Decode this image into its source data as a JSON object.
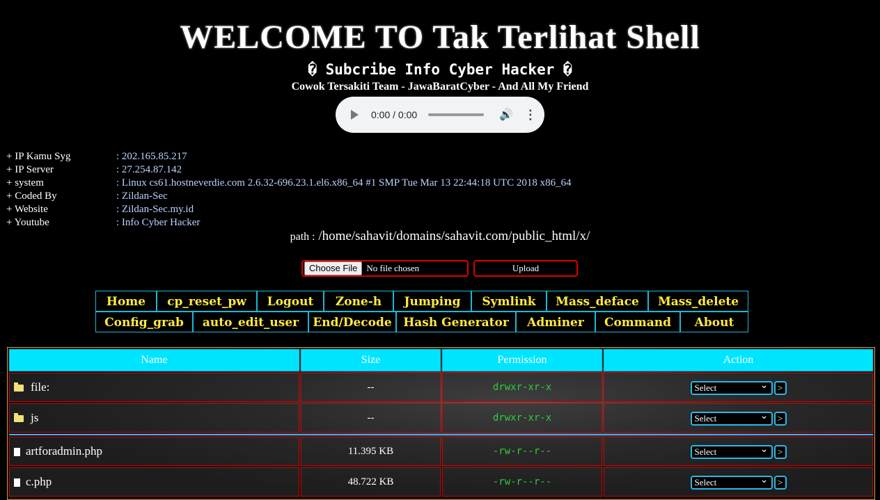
{
  "header": {
    "title": "WELCOME TO Tak Terlihat Shell",
    "subtitle": "� Subcribe Info Cyber Hacker �",
    "credits": "Cowok Tersakiti Team - JawaBaratCyber - And All My Friend"
  },
  "audio": {
    "time": "0:00 / 0:00"
  },
  "info": [
    {
      "key": "+ IP Kamu Syg",
      "value": ": 202.165.85.217"
    },
    {
      "key": "+ IP Server",
      "value": ": 27.254.87.142"
    },
    {
      "key": "+ system",
      "value": ": Linux cs61.hostneverdie.com 2.6.32-696.23.1.el6.x86_64 #1 SMP Tue Mar 13 22:44:18 UTC 2018 x86_64"
    },
    {
      "key": "+ Coded By",
      "value": ": Zildan-Sec"
    },
    {
      "key": "+ Website",
      "value": ": Zildan-Sec.my.id"
    },
    {
      "key": "+ Youtube",
      "value": ": Info Cyber Hacker"
    }
  ],
  "path": {
    "label": "path :",
    "value": "/home/sahavit/domains/sahavit.com/public_html/x/"
  },
  "upload": {
    "choose_label": "Choose File",
    "file_status": "No file chosen",
    "button_label": "Upload"
  },
  "menu": {
    "row1": [
      "Home",
      "cp_reset_pw",
      "Logout",
      "Zone-h",
      "Jumping",
      "Symlink",
      "Mass_deface",
      "Mass_delete"
    ],
    "row2": [
      "Config_grab",
      "auto_edit_user",
      "End/Decode",
      "Hash Generator",
      "Adminer",
      "Command",
      "About"
    ]
  },
  "table": {
    "headers": [
      "Name",
      "Size",
      "Permission",
      "Action"
    ],
    "rows": [
      {
        "type": "folder",
        "name": "file:",
        "size": "--",
        "perm": "drwxr-xr-x",
        "select": "Select",
        "go": ">"
      },
      {
        "type": "folder",
        "name": "js",
        "size": "--",
        "perm": "drwxr-xr-x",
        "select": "Select",
        "go": ">"
      },
      {
        "type": "file",
        "name": "artforadmin.php",
        "size": "11.395 KB",
        "perm": "-rw-r--r--",
        "select": "Select",
        "go": ">"
      },
      {
        "type": "file",
        "name": "c.php",
        "size": "48.722 KB",
        "perm": "-rw-r--r--",
        "select": "Select",
        "go": ">"
      }
    ]
  },
  "colors": {
    "accent": "#00e5ff",
    "menu_text": "#ffeb3b",
    "perm_text": "#2ecc40",
    "border_red": "#cc0000"
  }
}
